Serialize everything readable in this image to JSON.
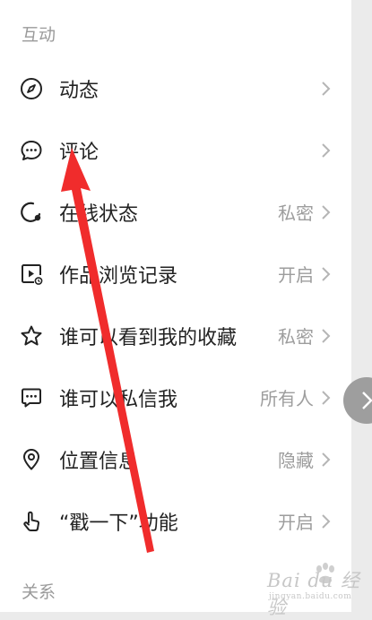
{
  "sections": {
    "interaction": "互动",
    "relations": "关系"
  },
  "rows": [
    {
      "label": "动态",
      "value": "",
      "icon": "compass-icon"
    },
    {
      "label": "评论",
      "value": "",
      "icon": "comment-bubble-icon"
    },
    {
      "label": "在线状态",
      "value": "私密",
      "icon": "online-status-icon"
    },
    {
      "label": "作品浏览记录",
      "value": "开启",
      "icon": "play-history-icon"
    },
    {
      "label": "谁可以看到我的收藏",
      "value": "私密",
      "icon": "star-icon"
    },
    {
      "label": "谁可以私信我",
      "value": "所有人",
      "icon": "message-icon"
    },
    {
      "label": "位置信息",
      "value": "隐藏",
      "icon": "location-pin-icon"
    },
    {
      "label": "“戳一下”功能",
      "value": "开启",
      "icon": "poke-hand-icon"
    }
  ],
  "watermark": {
    "brand": "Bai du 经验",
    "url": "jingyan.baidu.com"
  },
  "colors": {
    "annotation_arrow": "#f02c2c",
    "label_text": "#222222",
    "value_text": "#9d9d9d",
    "section_text": "#9a9a9a"
  }
}
